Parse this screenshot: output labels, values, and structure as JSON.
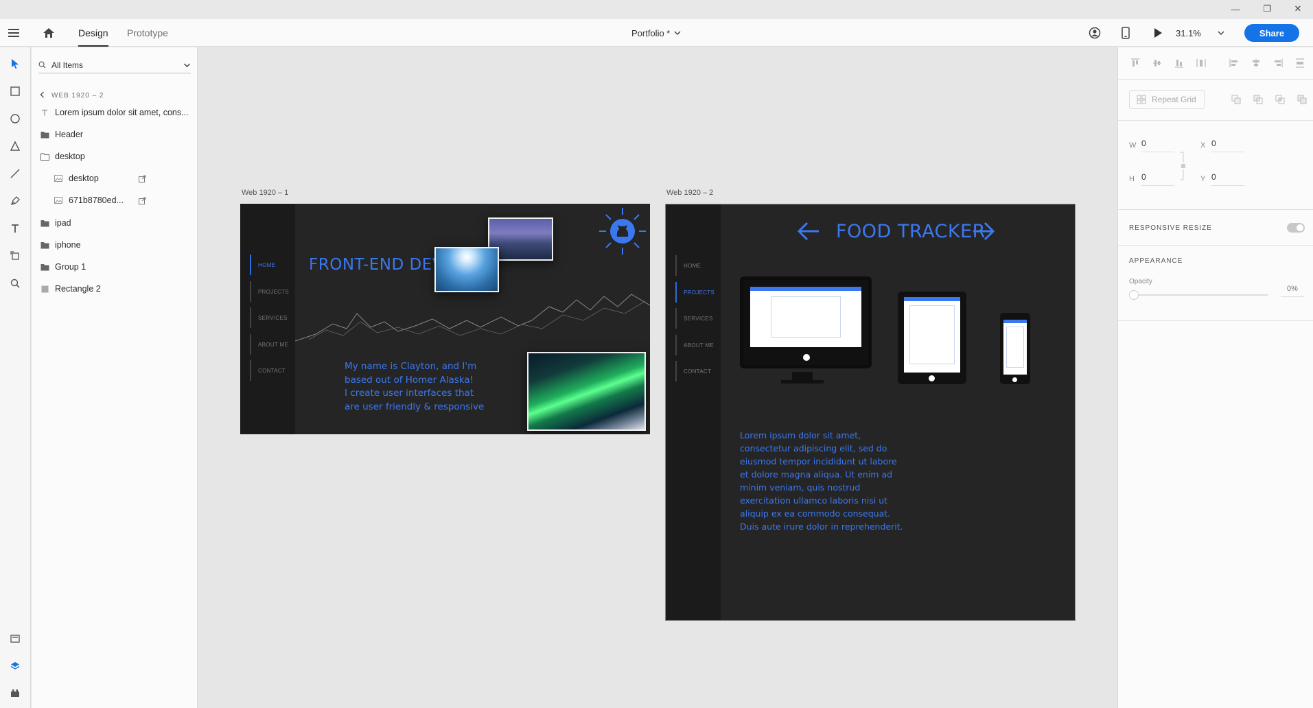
{
  "window": {
    "minimize": "—",
    "restore": "❐",
    "close": "✕"
  },
  "toolbar": {
    "tabs": [
      {
        "label": "Design"
      },
      {
        "label": "Prototype"
      }
    ],
    "doc_title": "Portfolio *",
    "zoom": "31.1%",
    "share_label": "Share"
  },
  "layers": {
    "search_placeholder": "All Items",
    "breadcrumb": "WEB 1920 – 2",
    "items": [
      {
        "label": "Lorem ipsum dolor sit amet, cons...",
        "icon": "text-layer-icon"
      },
      {
        "label": "Header",
        "icon": "folder-icon"
      },
      {
        "label": "desktop",
        "icon": "folder-icon"
      },
      {
        "label": "desktop",
        "icon": "image-layer-icon"
      },
      {
        "label": "671b8780ed...",
        "icon": "image-layer-icon"
      },
      {
        "label": "ipad",
        "icon": "folder-icon"
      },
      {
        "label": "iphone",
        "icon": "folder-icon"
      },
      {
        "label": "Group 1",
        "icon": "folder-icon"
      },
      {
        "label": "Rectangle 2",
        "icon": "rectangle-layer-icon"
      }
    ]
  },
  "artboard1": {
    "label": "Web 1920 – 1",
    "nav": [
      "HOME",
      "PROJECTS",
      "SERVICES",
      "ABOUT ME",
      "CONTACT"
    ],
    "title": "FRONT-END DEV",
    "bio": [
      "My name is Clayton, and I'm",
      "based out of Homer Alaska!",
      "I create user interfaces that",
      "are user friendly & responsive"
    ]
  },
  "artboard2": {
    "label": "Web 1920 – 2",
    "nav": [
      "HOME",
      "PROJECTS",
      "SERVICES",
      "ABOUT ME",
      "CONTACT"
    ],
    "title": "FOOD TRACKER",
    "body": [
      "Lorem ipsum dolor sit amet,",
      "consectetur adipiscing elit, sed do",
      "eiusmod tempor incididunt ut labore",
      "et dolore magna aliqua. Ut enim ad",
      "minim veniam, quis nostrud",
      "exercitation ullamco laboris nisi ut",
      "aliquip ex ea commodo consequat.",
      "Duis aute irure dolor in reprehenderit."
    ]
  },
  "properties": {
    "repeat_grid": "Repeat Grid",
    "w_label": "W",
    "w": "0",
    "h_label": "H",
    "h": "0",
    "x_label": "X",
    "x": "0",
    "y_label": "Y",
    "y": "0",
    "responsive_resize": "RESPONSIVE RESIZE",
    "appearance": "APPEARANCE",
    "opacity_label": "Opacity",
    "opacity_value": "0%"
  },
  "colors": {
    "accent": "#1473e6",
    "brand_blue": "#3b78f0",
    "artboard_bg": "#252525"
  }
}
